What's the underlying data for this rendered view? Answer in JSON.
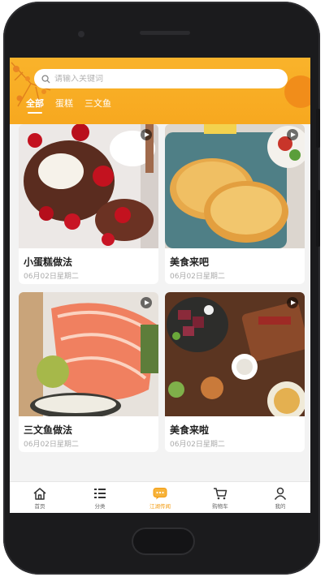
{
  "search": {
    "placeholder": "请输入关键词"
  },
  "tabs": [
    {
      "label": "全部",
      "active": true
    },
    {
      "label": "蛋糕",
      "active": false
    },
    {
      "label": "三文鱼",
      "active": false
    }
  ],
  "cards": [
    {
      "title": "小蛋糕做法",
      "date": "06月02日星期二",
      "image": "chocolate-cake-strawberries"
    },
    {
      "title": "美食来吧",
      "date": "06月02日星期二",
      "image": "flatbread-pancakes"
    },
    {
      "title": "三文鱼做法",
      "date": "06月02日星期二",
      "image": "salmon-sashimi"
    },
    {
      "title": "美食来啦",
      "date": "06月02日星期二",
      "image": "steak-board"
    }
  ],
  "tabbar": [
    {
      "label": "首页",
      "icon": "home-icon",
      "active": false
    },
    {
      "label": "分类",
      "icon": "list-icon",
      "active": false
    },
    {
      "label": "江湖传闻",
      "icon": "chat-icon",
      "active": true
    },
    {
      "label": "购物车",
      "icon": "cart-icon",
      "active": false
    },
    {
      "label": "我的",
      "icon": "user-icon",
      "active": false
    }
  ],
  "colors": {
    "accent": "#f39c12",
    "header": "#f7a81f"
  }
}
